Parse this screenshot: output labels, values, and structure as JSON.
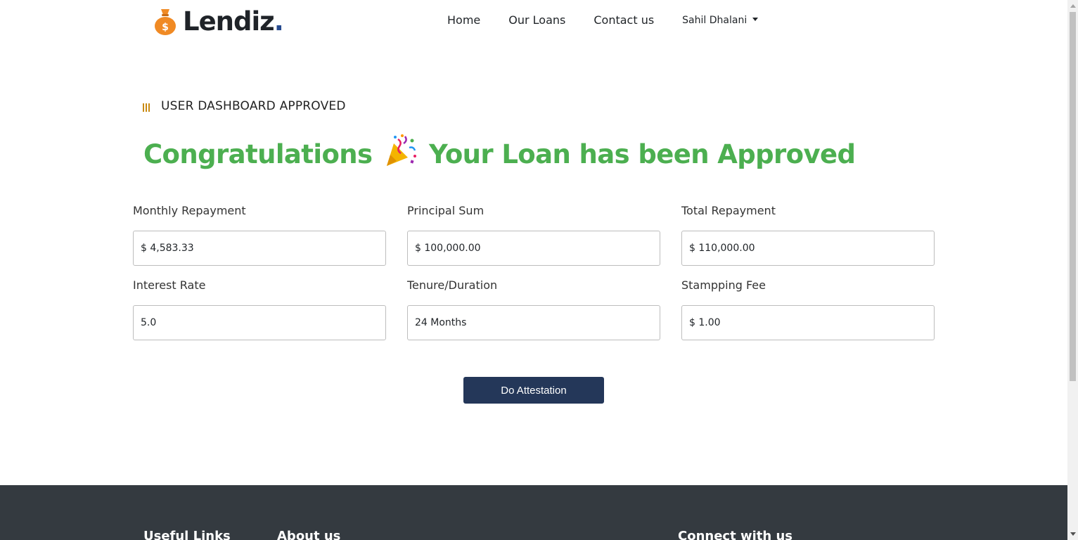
{
  "brand": {
    "name": "Lendiz",
    "dot": "."
  },
  "nav": {
    "items": [
      {
        "label": "Home"
      },
      {
        "label": "Our Loans"
      },
      {
        "label": "Contact us"
      }
    ],
    "user": "Sahil Dhalani"
  },
  "section": {
    "label": "USER DASHBOARD APPROVED"
  },
  "headline": {
    "part1": "Congratulations",
    "part2": "Your Loan has been Approved"
  },
  "fields": [
    {
      "label": "Monthly Repayment",
      "value": "$ 4,583.33"
    },
    {
      "label": "Principal Sum",
      "value": "$ 100,000.00"
    },
    {
      "label": "Total Repayment",
      "value": "$ 110,000.00"
    },
    {
      "label": "Interest Rate",
      "value": "5.0"
    },
    {
      "label": "Tenure/Duration",
      "value": "24 Months"
    },
    {
      "label": "Stampping Fee",
      "value": "$ 1.00"
    }
  ],
  "action": {
    "label": "Do Attestation"
  },
  "footer": {
    "headings": [
      "Useful Links",
      "About us",
      "Connect with us"
    ]
  },
  "colors": {
    "accent_green": "#4caf50",
    "button_navy": "#243759",
    "footer_bg": "#343a40",
    "brand_orange": "#f08a24"
  },
  "icons": {
    "logo": "money-bag-icon",
    "section": "bars-icon",
    "celebration": "party-popper-icon",
    "dropdown": "caret-down-icon"
  }
}
